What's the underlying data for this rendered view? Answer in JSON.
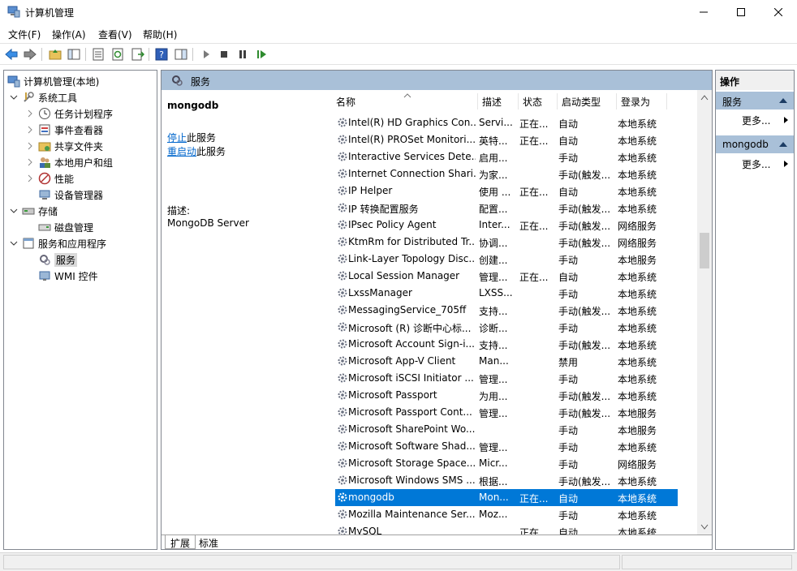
{
  "window": {
    "title": "计算机管理"
  },
  "menu": [
    "文件(F)",
    "操作(A)",
    "查看(V)",
    "帮助(H)"
  ],
  "tree": {
    "root": "计算机管理(本地)",
    "items": [
      {
        "label": "系统工具",
        "icon": "tools-icon"
      },
      {
        "label": "任务计划程序",
        "icon": "clock-icon"
      },
      {
        "label": "事件查看器",
        "icon": "event-viewer-icon"
      },
      {
        "label": "共享文件夹",
        "icon": "shared-folder-icon"
      },
      {
        "label": "本地用户和组",
        "icon": "users-icon"
      },
      {
        "label": "性能",
        "icon": "performance-icon"
      },
      {
        "label": "设备管理器",
        "icon": "device-manager-icon"
      },
      {
        "label": "存储",
        "icon": "storage-icon"
      },
      {
        "label": "磁盘管理",
        "icon": "disk-icon"
      },
      {
        "label": "服务和应用程序",
        "icon": "services-apps-icon"
      },
      {
        "label": "服务",
        "icon": "services-icon"
      },
      {
        "label": "WMI 控件",
        "icon": "wmi-icon"
      }
    ]
  },
  "panel": {
    "title": "服务"
  },
  "detail": {
    "service_name": "mongodb",
    "stop_link": "停止",
    "stop_suffix": "此服务",
    "restart_link": "重启动",
    "restart_suffix": "此服务",
    "desc_label": "描述:",
    "desc_text": "MongoDB Server"
  },
  "columns": [
    "名称",
    "描述",
    "状态",
    "启动类型",
    "登录为"
  ],
  "rows": [
    {
      "name": "Intel(R) HD Graphics Con...",
      "desc": "Servi...",
      "status": "正在...",
      "startup": "自动",
      "logon": "本地系统"
    },
    {
      "name": "Intel(R) PROSet Monitori...",
      "desc": "英特...",
      "status": "正在...",
      "startup": "自动",
      "logon": "本地系统"
    },
    {
      "name": "Interactive Services Dete...",
      "desc": "启用...",
      "status": "",
      "startup": "手动",
      "logon": "本地系统"
    },
    {
      "name": "Internet Connection Shari...",
      "desc": "为家...",
      "status": "",
      "startup": "手动(触发...",
      "logon": "本地系统"
    },
    {
      "name": "IP Helper",
      "desc": "使用 ...",
      "status": "正在...",
      "startup": "自动",
      "logon": "本地系统"
    },
    {
      "name": "IP 转换配置服务",
      "desc": "配置...",
      "status": "",
      "startup": "手动(触发...",
      "logon": "本地系统"
    },
    {
      "name": "IPsec Policy Agent",
      "desc": "Inter...",
      "status": "正在...",
      "startup": "手动(触发...",
      "logon": "网络服务"
    },
    {
      "name": "KtmRm for Distributed Tr...",
      "desc": "协调...",
      "status": "",
      "startup": "手动(触发...",
      "logon": "网络服务"
    },
    {
      "name": "Link-Layer Topology Disc...",
      "desc": "创建...",
      "status": "",
      "startup": "手动",
      "logon": "本地服务"
    },
    {
      "name": "Local Session Manager",
      "desc": "管理...",
      "status": "正在...",
      "startup": "自动",
      "logon": "本地系统"
    },
    {
      "name": "LxssManager",
      "desc": "LXSS...",
      "status": "",
      "startup": "手动",
      "logon": "本地系统"
    },
    {
      "name": "MessagingService_705ff",
      "desc": "支持...",
      "status": "",
      "startup": "手动(触发...",
      "logon": "本地系统"
    },
    {
      "name": "Microsoft (R) 诊断中心标...",
      "desc": "诊断...",
      "status": "",
      "startup": "手动",
      "logon": "本地系统"
    },
    {
      "name": "Microsoft Account Sign-i...",
      "desc": "支持...",
      "status": "",
      "startup": "手动(触发...",
      "logon": "本地系统"
    },
    {
      "name": "Microsoft App-V Client",
      "desc": "Man...",
      "status": "",
      "startup": "禁用",
      "logon": "本地系统"
    },
    {
      "name": "Microsoft iSCSI Initiator ...",
      "desc": "管理...",
      "status": "",
      "startup": "手动",
      "logon": "本地系统"
    },
    {
      "name": "Microsoft Passport",
      "desc": "为用...",
      "status": "",
      "startup": "手动(触发...",
      "logon": "本地系统"
    },
    {
      "name": "Microsoft Passport Cont...",
      "desc": "管理...",
      "status": "",
      "startup": "手动(触发...",
      "logon": "本地服务"
    },
    {
      "name": "Microsoft SharePoint Wo...",
      "desc": "",
      "status": "",
      "startup": "手动",
      "logon": "本地服务"
    },
    {
      "name": "Microsoft Software Shad...",
      "desc": "管理...",
      "status": "",
      "startup": "手动",
      "logon": "本地系统"
    },
    {
      "name": "Microsoft Storage Space...",
      "desc": "Micr...",
      "status": "",
      "startup": "手动",
      "logon": "网络服务"
    },
    {
      "name": "Microsoft Windows SMS ...",
      "desc": "根据...",
      "status": "",
      "startup": "手动(触发...",
      "logon": "本地系统"
    },
    {
      "name": "mongodb",
      "desc": "Mon...",
      "status": "正在...",
      "startup": "自动",
      "logon": "本地系统",
      "selected": true
    },
    {
      "name": "Mozilla Maintenance Ser...",
      "desc": "Moz...",
      "status": "",
      "startup": "手动",
      "logon": "本地系统"
    },
    {
      "name": "MySQL",
      "desc": "",
      "status": "正在...",
      "startup": "自动",
      "logon": "本地系统"
    }
  ],
  "tabs": [
    "扩展",
    "标准"
  ],
  "actions": {
    "header": "操作",
    "sections": [
      {
        "title": "服务",
        "more": "更多..."
      },
      {
        "title": "mongodb",
        "more": "更多..."
      }
    ]
  },
  "colors": {
    "selection": "#0078d7",
    "header_band": "#a9c0d8",
    "link": "#0066cc"
  }
}
